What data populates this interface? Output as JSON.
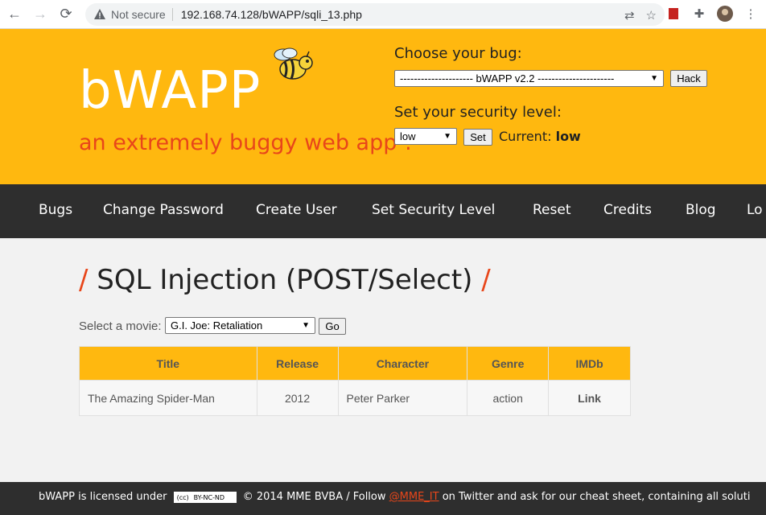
{
  "browser": {
    "not_secure": "Not secure",
    "url": "192.168.74.128/bWAPP/sqli_13.php"
  },
  "header": {
    "logo": "bWAPP",
    "tagline": "an extremely buggy web app !",
    "choose_bug_label": "Choose your bug:",
    "bug_select_value": "--------------------- bWAPP v2.2 ----------------------",
    "hack_button": "Hack",
    "security_label": "Set your security level:",
    "security_select_value": "low",
    "set_button": "Set",
    "current_label": "Current:",
    "current_value": "low"
  },
  "menu": {
    "items": [
      "Bugs",
      "Change Password",
      "Create User",
      "Set Security Level",
      "Reset",
      "Credits",
      "Blog",
      "Lo"
    ]
  },
  "main": {
    "title": "SQL Injection (POST/Select)",
    "slash": "/",
    "select_label": "Select a movie:",
    "movie_select_value": "G.I. Joe: Retaliation",
    "go_button": "Go",
    "table": {
      "headers": [
        "Title",
        "Release",
        "Character",
        "Genre",
        "IMDb"
      ],
      "rows": [
        [
          "The Amazing Spider-Man",
          "2012",
          "Peter Parker",
          "action",
          "Link"
        ]
      ]
    }
  },
  "footer": {
    "text_before": "bWAPP is licensed under",
    "cc_label": "BY-NC-ND",
    "text_middle": "© 2014 MME BVBA / Follow",
    "twitter_link": "@MME_IT",
    "text_after": "on Twitter and ask for our cheat sheet, containing all soluti"
  },
  "colors": {
    "header_bg": "#ffb80f",
    "accent": "#e8461a",
    "menubar_bg": "#2e2e2e"
  }
}
